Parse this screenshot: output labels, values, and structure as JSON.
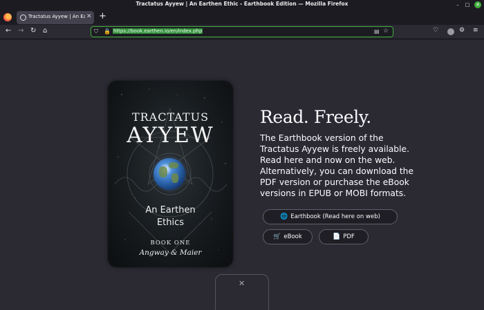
{
  "window": {
    "title": "Tractatus Ayyew | An Earthen Ethic - Earthbook Edition — Mozilla Firefox",
    "min_glyph": "–",
    "max_glyph": "□",
    "close_glyph": "✕"
  },
  "tabs": [
    {
      "title": "Tractatus Ayyew | An Earthe",
      "close_glyph": "✕"
    }
  ],
  "new_tab_glyph": "+",
  "nav": {
    "back_glyph": "←",
    "forward_glyph": "→",
    "reload_glyph": "↻",
    "home_glyph": "⌂"
  },
  "urlbar": {
    "url": "https://book.earthen.io/en/index.php",
    "shield_glyph": "⛉",
    "lock_glyph": "🔒",
    "reader_glyph": "▤",
    "star_glyph": "☆"
  },
  "toolbar": {
    "pocket_glyph": "♡",
    "extensions_glyph": "⚙",
    "menu_glyph": "≡"
  },
  "cover": {
    "line1": "TRACTATUS",
    "line2": "AYYEW",
    "subtitle_line1": "An Earthen",
    "subtitle_line2": "Ethics",
    "book_label": "BOOK ONE",
    "authors": "Angway & Maier"
  },
  "main": {
    "heading": "Read. Freely.",
    "description_lines": [
      "The Earthbook version of the",
      "Tractatus Ayyew is freely available.",
      "Read here and now on the web.",
      "Alternatively, you can download the",
      "PDF version or purchase the eBook",
      "versions in EPUB or MOBI formats."
    ],
    "buttons": {
      "earthbook": {
        "label": "Earthbook (Read here on web)",
        "icon": "globe-icon",
        "glyph": "🌐"
      },
      "ebook": {
        "label": "eBook",
        "icon": "cart-icon",
        "glyph": "🛒"
      },
      "pdf": {
        "label": "PDF",
        "icon": "document-icon",
        "glyph": "📄"
      }
    }
  },
  "float_panel": {
    "close_glyph": "✕"
  },
  "colors": {
    "page_bg": "#2b2a33",
    "chrome_bg": "#1c1b22",
    "url_highlight": "#2e8f37",
    "url_border": "#3fae3b",
    "button_border": "#62616b"
  }
}
